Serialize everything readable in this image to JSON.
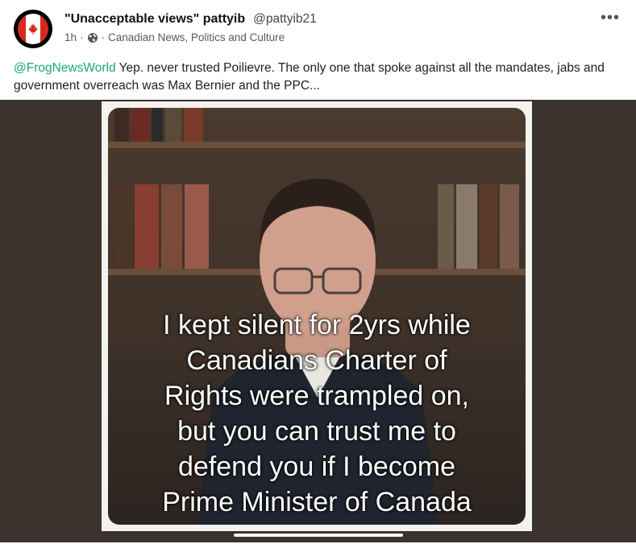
{
  "post": {
    "display_name": "\"Unacceptable views\" pattyib",
    "handle": "@pattyib21",
    "time": "1h",
    "separator": "·",
    "separator2": "·",
    "community": "Canadian News, Politics and Culture",
    "more_icon": "more-horizontal-icon",
    "globe_icon": "globe-icon",
    "text_mention": "@FrogNewsWorld",
    "text_body": " Yep. never trusted Poilievre. The only one that spoke against all the mandates, jabs and government overreach was Max Bernier and the PPC..."
  },
  "meme": {
    "lines": [
      "I kept silent for 2yrs while",
      "Canadians Charter of",
      "Rights were trampled on,",
      "but you can trust me to",
      "defend you if I become",
      "Prime Minister of Canada"
    ]
  },
  "colors": {
    "mention": "#19a974",
    "media_background": "#3b322d",
    "flag_red": "#d52b1e"
  }
}
